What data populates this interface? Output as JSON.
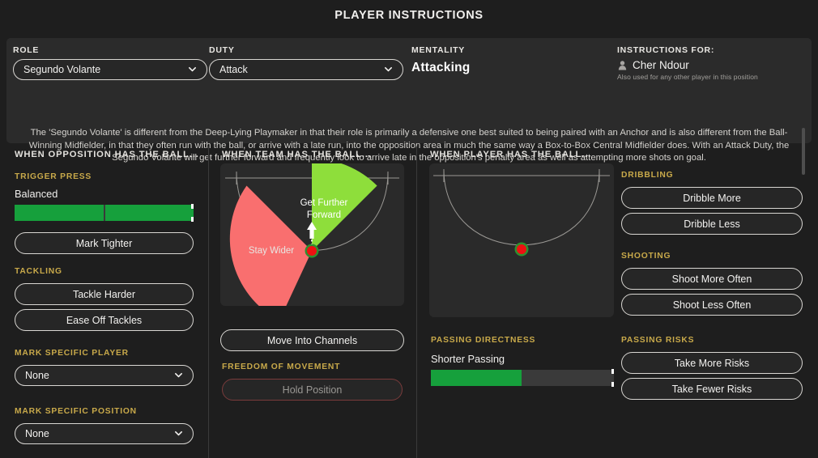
{
  "page": {
    "title": "PLAYER INSTRUCTIONS"
  },
  "header": {
    "role": {
      "label": "ROLE",
      "value": "Segundo Volante"
    },
    "duty": {
      "label": "DUTY",
      "value": "Attack"
    },
    "mentality": {
      "label": "MENTALITY",
      "value": "Attacking"
    },
    "instructions_for": {
      "label": "INSTRUCTIONS FOR:",
      "player_name": "Cher Ndour",
      "note": "Also used for any other player in this position",
      "icon": "player-silhouette-icon"
    },
    "description": "The 'Segundo Volante' is different from the Deep-Lying Playmaker in that their role is primarily a defensive one best suited to being paired with an Anchor and is also different from the Ball-Winning Midfielder, in that they often run with the ball, or arrive with a late run, into the opposition area in much the same way a Box-to-Box Central Midfielder does. With an Attack Duty, the Segundo Volante will get further forward and frequently look to arrive late in the opposition's penalty area as well as attempting more shots on goal."
  },
  "columns": {
    "opposition": {
      "heading": "WHEN OPPOSITION HAS THE BALL...",
      "trigger_press": {
        "label": "TRIGGER PRESS",
        "value": "Balanced",
        "segments": 2,
        "filled": 2,
        "marker_position_pct": 100
      },
      "mark_tighter": "Mark Tighter",
      "tackling": {
        "label": "TACKLING",
        "options": [
          "Tackle Harder",
          "Ease Off Tackles"
        ]
      },
      "mark_specific_player": {
        "label": "MARK SPECIFIC PLAYER",
        "value": "None"
      },
      "mark_specific_position": {
        "label": "MARK SPECIFIC POSITION",
        "value": "None"
      }
    },
    "team": {
      "heading": "WHEN TEAM HAS THE BALL...",
      "pitch": {
        "wedge_forward_label": "Get Further Forward",
        "wedge_wider_label": "Stay Wider",
        "wedge_forward_color": "#8ede3b",
        "wedge_wider_color": "#f96f6f",
        "marker_fill": "#ee1111",
        "marker_ring": "#2f8f2f"
      },
      "move_into_channels": "Move Into Channels",
      "freedom_of_movement": {
        "label": "FREEDOM OF MOVEMENT",
        "option": "Hold Position",
        "disabled": true
      }
    },
    "player": {
      "heading": "WHEN PLAYER HAS THE BALL...",
      "pitch": {
        "marker_fill": "#ee1111",
        "marker_ring": "#2f8f2f"
      },
      "passing_directness": {
        "label": "PASSING DIRECTNESS",
        "value": "Shorter Passing",
        "fill_pct": 50,
        "marker_position_pct": 100
      },
      "dribbling": {
        "label": "DRIBBLING",
        "options": [
          "Dribble More",
          "Dribble Less"
        ]
      },
      "shooting": {
        "label": "SHOOTING",
        "options": [
          "Shoot More Often",
          "Shoot Less Often"
        ]
      },
      "passing_risks": {
        "label": "PASSING RISKS",
        "options": [
          "Take More Risks",
          "Take Fewer Risks"
        ]
      }
    }
  }
}
